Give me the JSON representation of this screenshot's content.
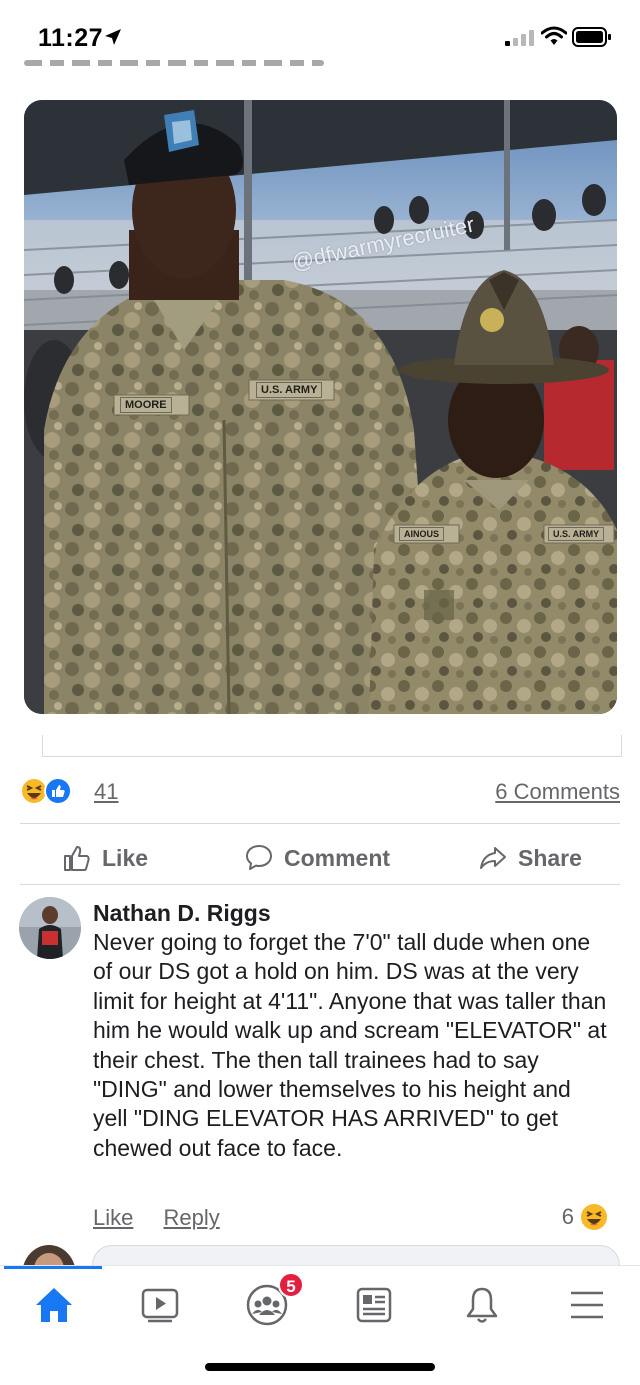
{
  "status_bar": {
    "time": "11:27",
    "icons": [
      "location-arrow-icon",
      "cellular-signal-icon",
      "wifi-icon",
      "battery-icon"
    ]
  },
  "post": {
    "photo": {
      "description_icon": "photo",
      "watermark": "@dfwarmyrecruiter",
      "name_tape_left": "MOORE",
      "branch_tape_left": "U.S. ARMY",
      "name_tape_right": "AINOUS",
      "branch_tape_right": "U.S. ARMY"
    },
    "reaction_count": "41",
    "reaction_icons": [
      "haha-emoji-icon",
      "like-thumb-icon"
    ],
    "comments_count": "6 Comments"
  },
  "actions": {
    "like": "Like",
    "comment": "Comment",
    "share": "Share"
  },
  "comment": {
    "author": "Nathan D. Riggs",
    "text": "Never going to forget the 7'0\" tall dude when one of our DS got a hold on him. DS was at the very limit for height at 4'11\". Anyone that was taller than him he would walk up and scream \"ELEVATOR\" at their chest. The then tall trainees had to say \"DING\" and lower themselves to his height and yell \"DING ELEVATOR HAS ARRIVED\" to get chewed out face to face.",
    "like_label": "Like",
    "reply_label": "Reply",
    "reaction_count": "6"
  },
  "tabbar": {
    "tabs": [
      "home",
      "watch",
      "groups",
      "news",
      "notifications",
      "menu"
    ],
    "groups_badge": "5",
    "accent": "#1877f2"
  },
  "colors": {
    "accent": "#1877f2",
    "badge": "#e41e3f",
    "secondary_text": "#65676b"
  }
}
